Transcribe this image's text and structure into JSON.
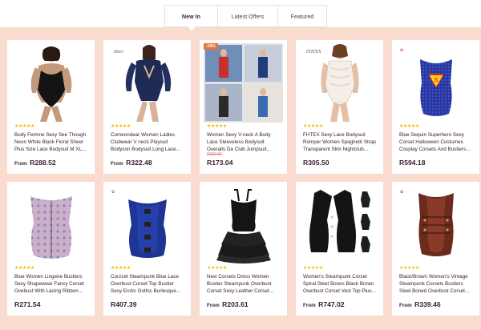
{
  "tabs": [
    {
      "label": "New In",
      "active": true
    },
    {
      "label": "Latest Offers",
      "active": false
    },
    {
      "label": "Featured",
      "active": false
    }
  ],
  "colors": {
    "background_band": "#f9dccf",
    "price_text": "#3a2030",
    "star": "#f6b900",
    "sale_badge": "#e9723d"
  },
  "products": [
    {
      "title": "Body Femme Sexy See Though Neon White Black Floral Sheer Plus Size Lace Bodysuit M XL...",
      "rating": 4.5,
      "stars": "★★★★★",
      "price_prefix": "From",
      "price": "R288.52",
      "old_price": "",
      "icon": "black-lace-bodysuit-icon"
    },
    {
      "title": "Comeondear Women Ladies Clubwear V neck Playsuit Bodycon Bodysuit Long Lace...",
      "rating": 5,
      "stars": "★★★★★",
      "price_prefix": "From",
      "price": "R322.48",
      "old_price": "",
      "brand": "Deer",
      "icon": "navy-lace-bodysuit-icon"
    },
    {
      "title": "Women Sexy V-neck A Body Lace Sleeveless Bodysuit Overalls Da Club Jumpsuit...",
      "rating": 4.5,
      "stars": "★★★★★",
      "price_prefix": "",
      "price": "R173.04",
      "old_price": "R203.57",
      "badge": "-15%",
      "icon": "jumpsuit-collage-icon"
    },
    {
      "title": "FHTEX Sexy Lace Bodysuit Romper Women Spaghetti Strap Transparent Slim Nightclub...",
      "rating": 5,
      "stars": "★★★★★",
      "price_prefix": "",
      "price": "R305.50",
      "old_price": "",
      "brand": "FHTEX",
      "icon": "white-lace-romper-icon"
    },
    {
      "title": "Blue Sequin Superhero Sexy Corset Halloween Costumes Cosplay Corsets And Bustiers...",
      "rating": 5,
      "stars": "★★★★★",
      "price_prefix": "",
      "price": "R594.18",
      "old_price": "",
      "icon": "blue-sequin-corset-icon"
    },
    {
      "title": "Blue Women Lingeire Bustiers Sexy Shapewear Fancy Corset Ovebust With Lacing Ribbon...",
      "rating": 4.5,
      "stars": "★★★★★",
      "price_prefix": "",
      "price": "R271.54",
      "old_price": "",
      "icon": "floral-corset-icon"
    },
    {
      "title": "Corzzet Steampunk Blue Lace Overbust Corset Top Bustier Sexy Erotic Gothic Burlesque...",
      "rating": 5,
      "stars": "★★★★★",
      "price_prefix": "",
      "price": "R407.39",
      "old_price": "",
      "icon": "blue-lace-corset-icon"
    },
    {
      "title": "New Corsets Dress Women Bustier Steampunk Overbust Corset Sexy Leather Corset...",
      "rating": 5,
      "stars": "★★★★★",
      "price_prefix": "From",
      "price": "R203.61",
      "old_price": "",
      "icon": "black-corset-dress-icon"
    },
    {
      "title": "Women's Steampunk Corset Spiral Steel Bones Black Brown Overbust Corset Vest Top Plus...",
      "rating": 5,
      "stars": "★★★★★",
      "price_prefix": "From",
      "price": "R747.02",
      "old_price": "",
      "icon": "black-vest-corset-icon"
    },
    {
      "title": "Black/Brown Women's Vintage Steampunk Corsets Bustiers Steel Boned Overbust Corset...",
      "rating": 5,
      "stars": "★★★★★",
      "price_prefix": "From",
      "price": "R339.46",
      "old_price": "",
      "icon": "brown-steampunk-corset-icon"
    }
  ]
}
